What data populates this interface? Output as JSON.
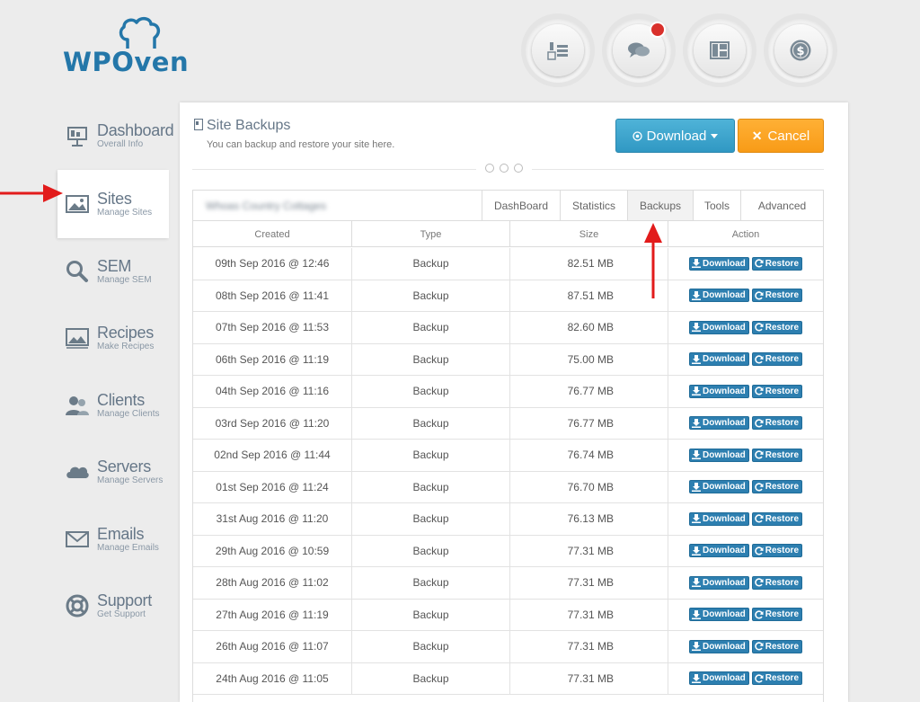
{
  "brand": {
    "logo_text": "WPOven",
    "accent": "#2477a9"
  },
  "top_buttons": [
    {
      "name": "billing-icon"
    },
    {
      "name": "chat-icon",
      "badge": ""
    },
    {
      "name": "dashboard-layout-icon"
    },
    {
      "name": "dollar-icon"
    }
  ],
  "sidebar": {
    "items": [
      {
        "title": "Dashboard",
        "sub": "Overall Info",
        "icon": "dashboard-icon"
      },
      {
        "title": "Sites",
        "sub": "Manage Sites",
        "icon": "image-icon"
      },
      {
        "title": "SEM",
        "sub": "Manage SEM",
        "icon": "magnifier-icon"
      },
      {
        "title": "Recipes",
        "sub": "Make Recipes",
        "icon": "recipes-icon"
      },
      {
        "title": "Clients",
        "sub": "Manage Clients",
        "icon": "users-icon"
      },
      {
        "title": "Servers",
        "sub": "Manage Servers",
        "icon": "cloud-icon"
      },
      {
        "title": "Emails",
        "sub": "Manage Emails",
        "icon": "envelope-icon"
      },
      {
        "title": "Support",
        "sub": "Get Support",
        "icon": "lifebuoy-icon"
      }
    ]
  },
  "panel": {
    "title": "Site Backups",
    "subtitle": "You can backup and restore your site here.",
    "download_label": "Download",
    "cancel_label": "Cancel"
  },
  "table": {
    "site_name": "Whoas Country Cottages",
    "tabs": [
      "DashBoard",
      "Statistics",
      "Backups",
      "Tools",
      "Advanced"
    ],
    "active_tab": "Backups",
    "columns": [
      "Created",
      "Type",
      "Size",
      "Action"
    ],
    "download_btn": "Download",
    "restore_btn": "Restore",
    "rows": [
      {
        "created": "09th Sep 2016 @ 12:46",
        "type": "Backup",
        "size": "82.51 MB"
      },
      {
        "created": "08th Sep 2016 @ 11:41",
        "type": "Backup",
        "size": "87.51 MB"
      },
      {
        "created": "07th Sep 2016 @ 11:53",
        "type": "Backup",
        "size": "82.60 MB"
      },
      {
        "created": "06th Sep 2016 @ 11:19",
        "type": "Backup",
        "size": "75.00 MB"
      },
      {
        "created": "04th Sep 2016 @ 11:16",
        "type": "Backup",
        "size": "76.77 MB"
      },
      {
        "created": "03rd Sep 2016 @ 11:20",
        "type": "Backup",
        "size": "76.77 MB"
      },
      {
        "created": "02nd Sep 2016 @ 11:44",
        "type": "Backup",
        "size": "76.74 MB"
      },
      {
        "created": "01st Sep 2016 @ 11:24",
        "type": "Backup",
        "size": "76.70 MB"
      },
      {
        "created": "31st Aug 2016 @ 11:20",
        "type": "Backup",
        "size": "76.13 MB"
      },
      {
        "created": "29th Aug 2016 @ 10:59",
        "type": "Backup",
        "size": "77.31 MB"
      },
      {
        "created": "28th Aug 2016 @ 11:02",
        "type": "Backup",
        "size": "77.31 MB"
      },
      {
        "created": "27th Aug 2016 @ 11:19",
        "type": "Backup",
        "size": "77.31 MB"
      },
      {
        "created": "26th Aug 2016 @ 11:07",
        "type": "Backup",
        "size": "77.31 MB"
      },
      {
        "created": "24th Aug 2016 @ 11:05",
        "type": "Backup",
        "size": "77.31 MB"
      }
    ]
  },
  "colors": {
    "download_btn": "#3aa3cd",
    "cancel_btn": "#f9a11f",
    "action_btn": "#2d7fb0",
    "annotation_arrow": "#e21b1b"
  }
}
